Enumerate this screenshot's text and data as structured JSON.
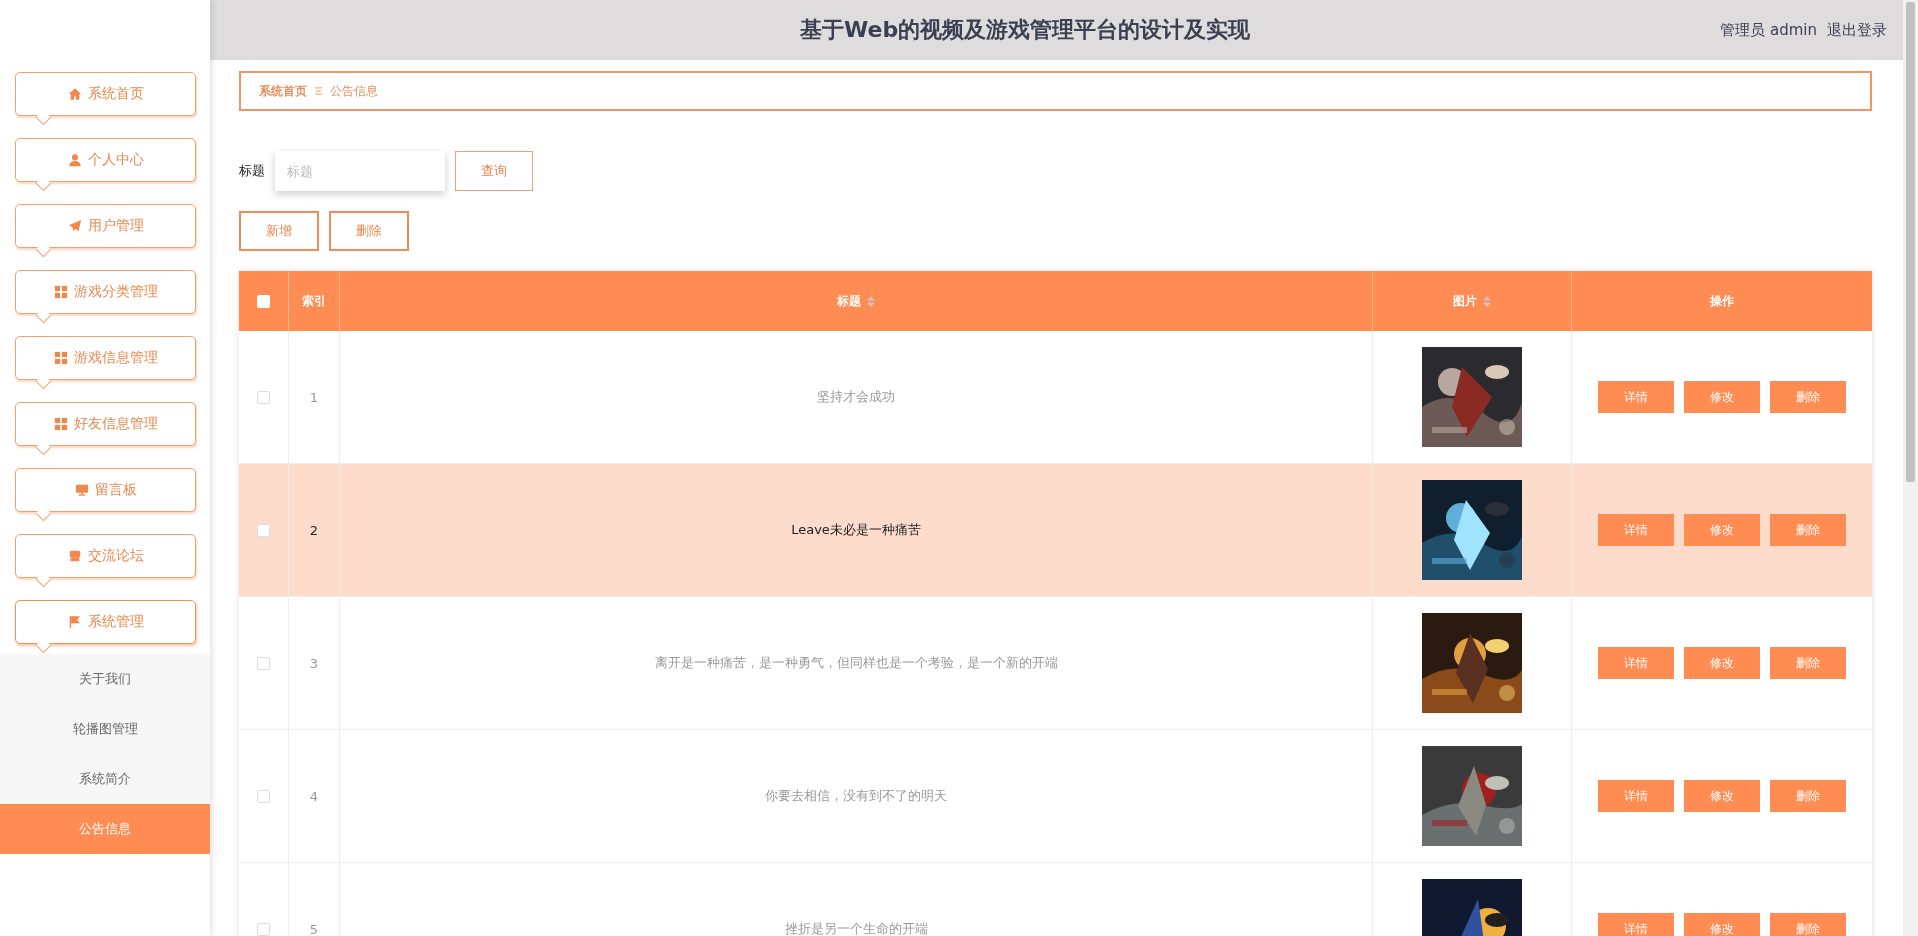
{
  "header": {
    "title": "基于Web的视频及游戏管理平台的设计及实现",
    "user": "管理员 admin",
    "logout": "退出登录"
  },
  "sidebar": {
    "items": [
      {
        "label": "系统首页"
      },
      {
        "label": "个人中心"
      },
      {
        "label": "用户管理"
      },
      {
        "label": "游戏分类管理"
      },
      {
        "label": "游戏信息管理"
      },
      {
        "label": "好友信息管理"
      },
      {
        "label": "留言板"
      },
      {
        "label": "交流论坛"
      },
      {
        "label": "系统管理",
        "expanded": true,
        "children": [
          {
            "label": "关于我们",
            "selected": false
          },
          {
            "label": "轮播图管理",
            "selected": false
          },
          {
            "label": "系统简介",
            "selected": false
          },
          {
            "label": "公告信息",
            "selected": true
          }
        ]
      }
    ]
  },
  "breadcrumb": [
    "系统首页",
    "公告信息"
  ],
  "search": {
    "label": "标题",
    "placeholder": "标题",
    "button": "查询"
  },
  "actions": [
    "新增",
    "删除"
  ],
  "table": {
    "select_all": false,
    "columns": [
      {
        "label": "索引",
        "sortable": false
      },
      {
        "label": "标题",
        "sortable": true
      },
      {
        "label": "图片",
        "sortable": true
      },
      {
        "label": "操作",
        "sortable": false
      }
    ],
    "rows": [
      {
        "index": "1",
        "title": "坚持才会成功",
        "checked": false,
        "highlighted": false,
        "picture": {
          "kind": "picture"
        },
        "actions": [
          "详情",
          "修改",
          "删除"
        ]
      },
      {
        "index": "2",
        "title": "Leave未必是一种痛苦",
        "checked": false,
        "highlighted": true,
        "picture": {
          "kind": "picture"
        },
        "actions": [
          "详情",
          "修改",
          "删除"
        ]
      },
      {
        "index": "3",
        "title": "离开是一种痛苦，是一种勇气，但同样也是一个考验，是一个新的开端",
        "checked": false,
        "highlighted": false,
        "picture": {
          "kind": "picture"
        },
        "actions": [
          "详情",
          "修改",
          "删除"
        ]
      },
      {
        "index": "4",
        "title": "你要去相信，没有到不了的明天",
        "checked": false,
        "highlighted": false,
        "picture": {
          "kind": "picture"
        },
        "actions": [
          "详情",
          "修改",
          "删除"
        ]
      },
      {
        "index": "5",
        "title": "挫折是另一个生命的开端",
        "checked": false,
        "highlighted": false,
        "picture": {
          "kind": "picture"
        },
        "actions": [
          "详情",
          "修改",
          "删除"
        ]
      }
    ]
  }
}
